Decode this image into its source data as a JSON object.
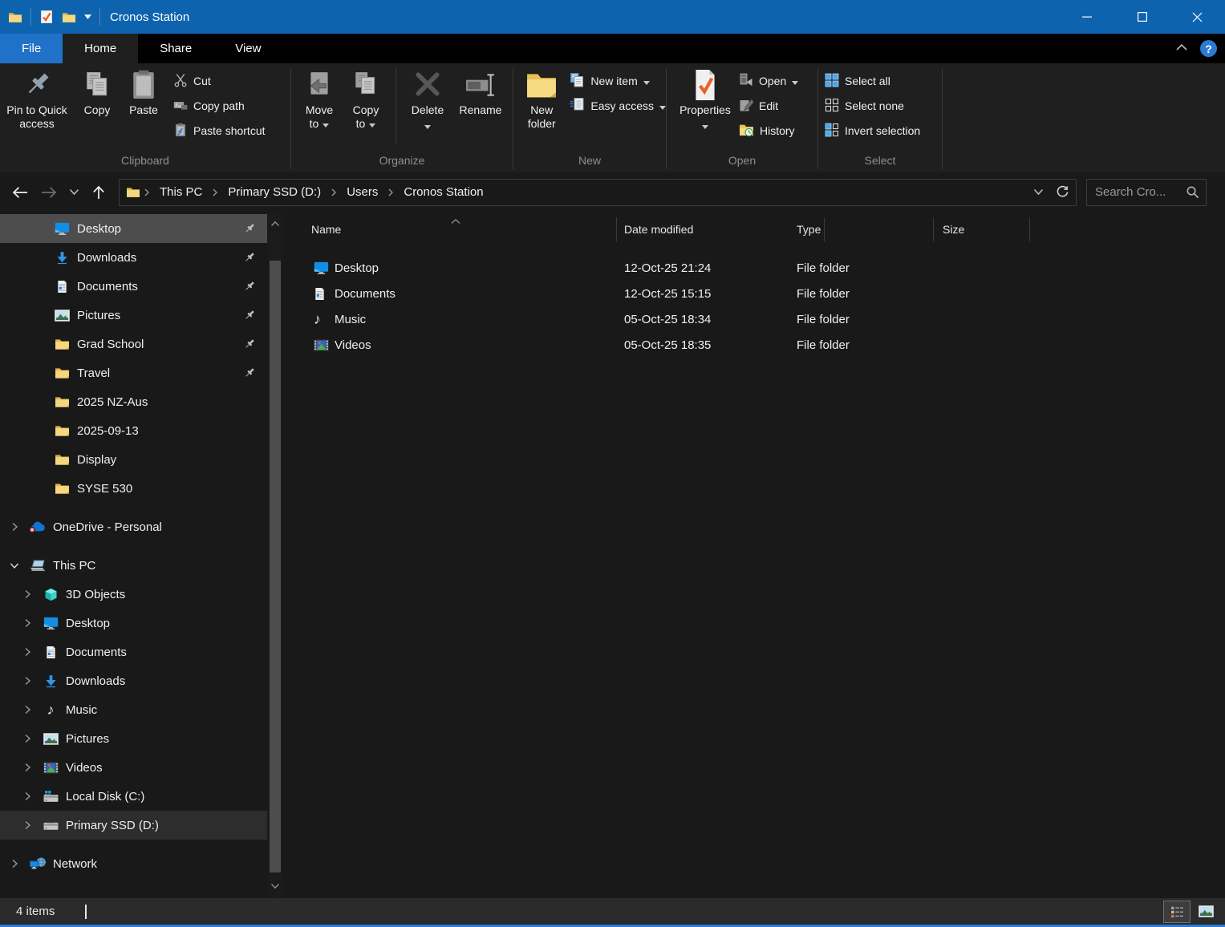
{
  "titlebar": {
    "title": "Cronos Station"
  },
  "tabs": {
    "items": [
      {
        "label": "File",
        "accent": true
      },
      {
        "label": "Home",
        "active": true
      },
      {
        "label": "Share"
      },
      {
        "label": "View"
      }
    ],
    "help_label": "?"
  },
  "ribbon": {
    "clipboard": {
      "label": "Clipboard",
      "pin_to_quick_access": "Pin to Quick access",
      "copy": "Copy",
      "paste": "Paste",
      "cut": "Cut",
      "copy_path": "Copy path",
      "paste_shortcut": "Paste shortcut"
    },
    "organize": {
      "label": "Organize",
      "move_to": "Move to",
      "copy_to": "Copy to",
      "delete": "Delete",
      "rename": "Rename"
    },
    "new": {
      "label": "New",
      "new_folder": "New folder",
      "new_item": "New item",
      "easy_access": "Easy access"
    },
    "open": {
      "label": "Open",
      "properties": "Properties",
      "open": "Open",
      "edit": "Edit",
      "history": "History"
    },
    "select": {
      "label": "Select",
      "select_all": "Select all",
      "select_none": "Select none",
      "invert": "Invert selection"
    }
  },
  "address_bar": {
    "breadcrumb": [
      "This PC",
      "Primary SSD (D:)",
      "Users",
      "Cronos Station"
    ],
    "search_placeholder": "Search Cro..."
  },
  "sidebar": {
    "quick_access_items": [
      {
        "label": "Desktop",
        "icon": "desktop",
        "pinned": true,
        "selected": true
      },
      {
        "label": "Downloads",
        "icon": "downloads",
        "pinned": true
      },
      {
        "label": "Documents",
        "icon": "documents",
        "pinned": true
      },
      {
        "label": "Pictures",
        "icon": "pictures",
        "pinned": true
      },
      {
        "label": "Grad School",
        "icon": "folder",
        "pinned": true
      },
      {
        "label": "Travel",
        "icon": "folder",
        "pinned": true
      },
      {
        "label": "2025 NZ-Aus",
        "icon": "folder",
        "pinned": false
      },
      {
        "label": "2025-09-13",
        "icon": "folder",
        "pinned": false
      },
      {
        "label": "Display",
        "icon": "folder",
        "pinned": false
      },
      {
        "label": "SYSE 530",
        "icon": "folder",
        "pinned": false
      }
    ],
    "onedrive": {
      "label": "OneDrive - Personal",
      "icon": "onedrive",
      "expander": "right"
    },
    "this_pc": {
      "label": "This PC",
      "icon": "computer",
      "expander": "down",
      "children": [
        {
          "label": "3D Objects",
          "icon": "objects3d"
        },
        {
          "label": "Desktop",
          "icon": "desktop"
        },
        {
          "label": "Documents",
          "icon": "documents"
        },
        {
          "label": "Downloads",
          "icon": "downloads"
        },
        {
          "label": "Music",
          "icon": "music"
        },
        {
          "label": "Pictures",
          "icon": "pictures"
        },
        {
          "label": "Videos",
          "icon": "videos"
        },
        {
          "label": "Local Disk (C:)",
          "icon": "drivec"
        },
        {
          "label": "Primary SSD (D:)",
          "icon": "drive",
          "highlighted": true
        }
      ]
    },
    "network": {
      "label": "Network",
      "icon": "network",
      "expander": "right"
    }
  },
  "file_list": {
    "columns": [
      {
        "label": "Name",
        "sorted": "asc"
      },
      {
        "label": "Date modified"
      },
      {
        "label": "Type"
      },
      {
        "label": "Size"
      }
    ],
    "rows": [
      {
        "name": "Desktop",
        "icon": "desktop",
        "date_modified": "12-Oct-25 21:24",
        "type": "File folder",
        "size": ""
      },
      {
        "name": "Documents",
        "icon": "documents",
        "date_modified": "12-Oct-25 15:15",
        "type": "File folder",
        "size": ""
      },
      {
        "name": "Music",
        "icon": "music",
        "date_modified": "05-Oct-25 18:34",
        "type": "File folder",
        "size": ""
      },
      {
        "name": "Videos",
        "icon": "videos",
        "date_modified": "05-Oct-25 18:35",
        "type": "File folder",
        "size": ""
      }
    ]
  },
  "status_bar": {
    "items_count": "4 items"
  },
  "colors": {
    "titlebar_blue": "#0e63ae",
    "file_tab_blue": "#2072c8",
    "accent_border": "#2b7bd4",
    "selection_gray": "#4d4d4d",
    "folder_yellow": "#f5d77f"
  }
}
